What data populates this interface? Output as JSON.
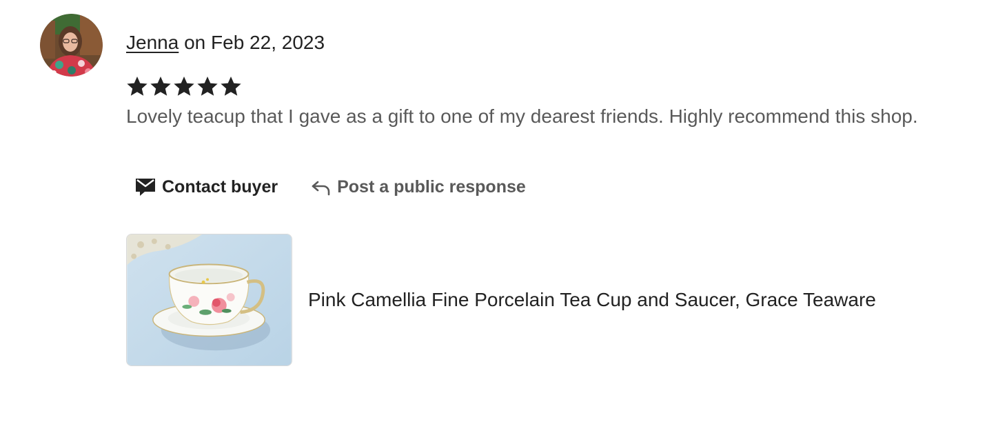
{
  "review": {
    "reviewer_name": "Jenna",
    "date_prefix": "on",
    "date": "Feb 22, 2023",
    "rating": 5,
    "rating_max": 5,
    "text": "Lovely teacup that I gave as a gift to one of my dearest friends. Highly recommend this shop."
  },
  "actions": {
    "contact_label": "Contact buyer",
    "contact_icon": "envelope-icon",
    "respond_label": "Post a public response",
    "respond_icon": "reply-arrow-icon"
  },
  "listing": {
    "title": "Pink Camellia Fine Porcelain Tea Cup and Saucer, Grace Teaware"
  },
  "colors": {
    "text_primary": "#222222",
    "text_secondary": "#595959",
    "star": "#222222"
  }
}
